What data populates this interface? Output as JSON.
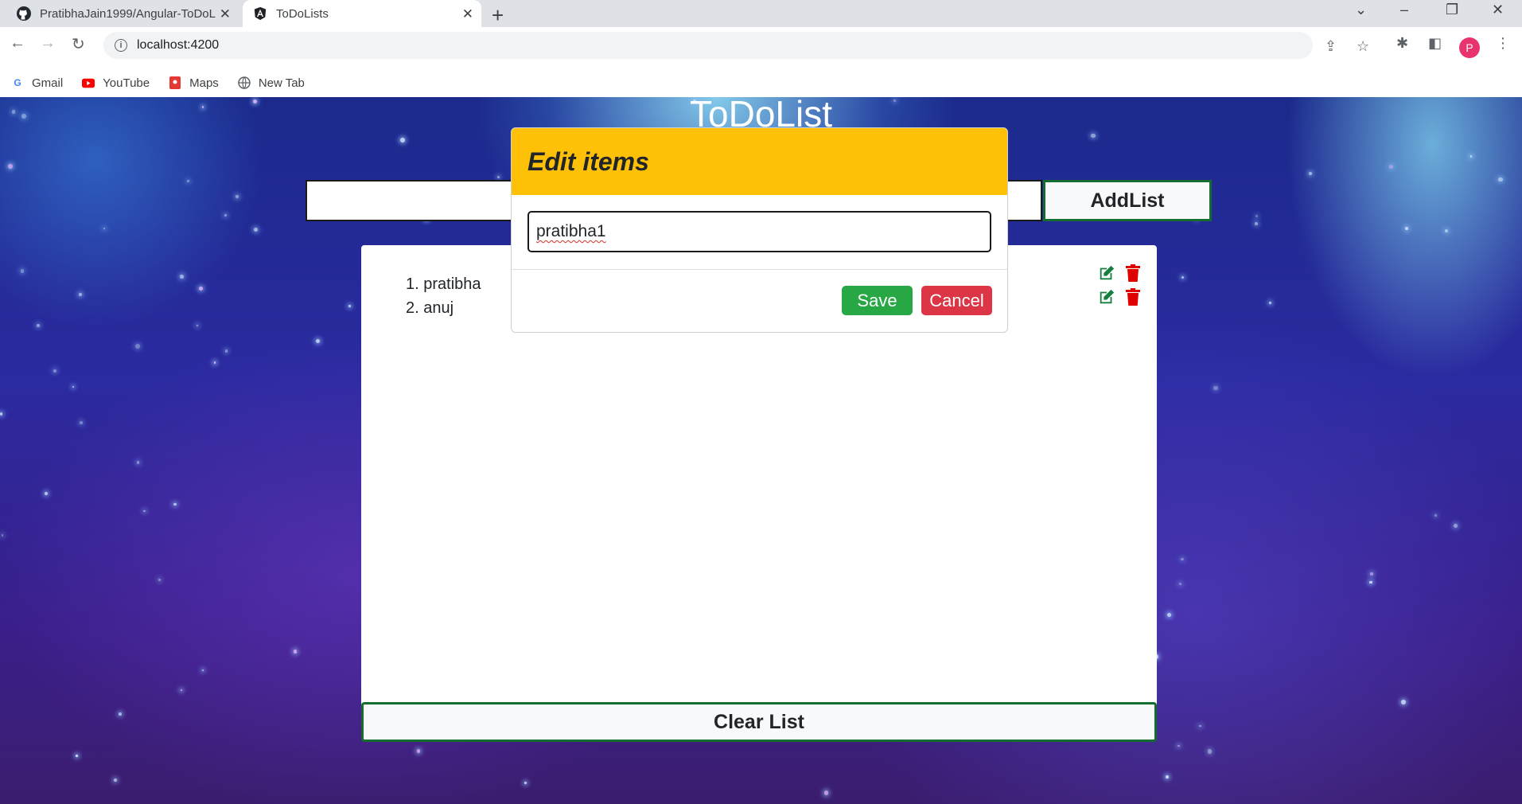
{
  "browser": {
    "tabs": [
      {
        "title": "PratibhaJain1999/Angular-ToDoL",
        "icon": "github-icon"
      },
      {
        "title": "ToDoLists",
        "icon": "angular-icon"
      }
    ],
    "url": "localhost:4200",
    "profile_initial": "P",
    "bookmarks": [
      {
        "label": "Gmail",
        "icon": "google-icon"
      },
      {
        "label": "YouTube",
        "icon": "youtube-icon"
      },
      {
        "label": "Maps",
        "icon": "maps-icon"
      },
      {
        "label": "New Tab",
        "icon": "globe-icon"
      }
    ]
  },
  "app": {
    "title": "ToDoList",
    "add_input_value": "",
    "add_button": "AddList",
    "items": [
      {
        "label": "1. pratibha"
      },
      {
        "label": "2. anuj"
      }
    ],
    "clear_button": "Clear List"
  },
  "modal": {
    "title": "Edit items",
    "input_value": "pratibha1",
    "save_label": "Save",
    "cancel_label": "Cancel"
  },
  "colors": {
    "modal_header": "#ffc107",
    "save": "#28a745",
    "cancel": "#dc3545",
    "edit_icon": "#15803d",
    "delete_icon": "#e00000",
    "button_border": "#146c2e"
  }
}
